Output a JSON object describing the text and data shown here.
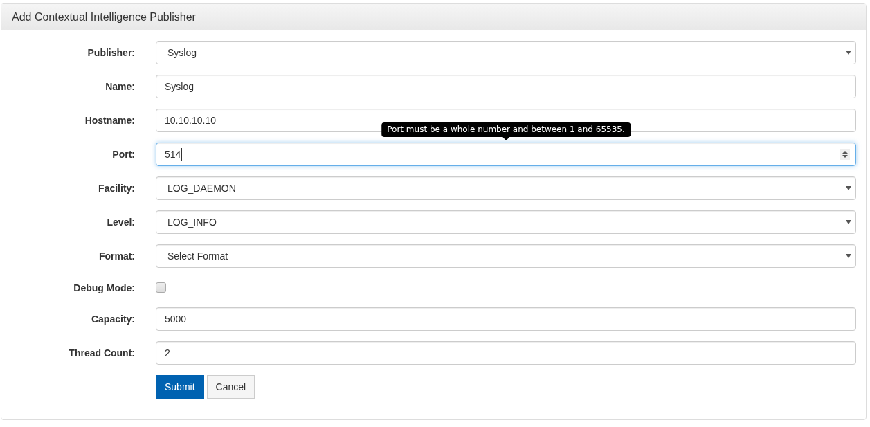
{
  "panel": {
    "title": "Add Contextual Intelligence Publisher"
  },
  "fields": [
    {
      "kind": "select",
      "label": "Publisher:",
      "value": "Syslog",
      "focused": false
    },
    {
      "kind": "text",
      "label": "Name:",
      "value": "Syslog",
      "focused": false
    },
    {
      "kind": "text",
      "label": "Hostname:",
      "value": "10.10.10.10",
      "focused": false
    },
    {
      "kind": "number",
      "label": "Port:",
      "value": "514",
      "focused": true,
      "tooltip": "Port must be a whole number and between 1 and 65535."
    },
    {
      "kind": "select",
      "label": "Facility:",
      "value": "LOG_DAEMON",
      "focused": false
    },
    {
      "kind": "select",
      "label": "Level:",
      "value": "LOG_INFO",
      "focused": false
    },
    {
      "kind": "select",
      "label": "Format:",
      "value": "Select Format",
      "focused": false
    },
    {
      "kind": "checkbox",
      "label": "Debug Mode:",
      "checked": false
    },
    {
      "kind": "text",
      "label": "Capacity:",
      "value": "5000",
      "focused": false
    },
    {
      "kind": "text",
      "label": "Thread Count:",
      "value": "2",
      "focused": false
    }
  ],
  "buttons": [
    {
      "kind": "primary",
      "label": "Submit"
    },
    {
      "kind": "default",
      "label": "Cancel"
    }
  ]
}
